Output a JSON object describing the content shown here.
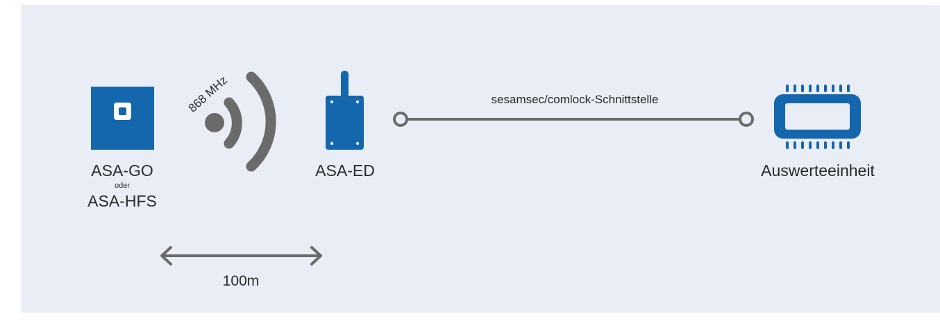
{
  "devices": {
    "sensor": {
      "name_primary": "ASA-GO",
      "connector_word": "oder",
      "name_secondary": "ASA-HFS"
    },
    "radio": {
      "frequency": "868 MHz"
    },
    "receiver": {
      "name": "ASA-ED"
    },
    "interface": {
      "label": "sesamsec/comlock-Schnittstelle"
    },
    "evaluation_unit": {
      "name": "Auswerteeinheit"
    }
  },
  "range": {
    "label": "100m"
  },
  "colors": {
    "background": "#e9edf6",
    "device_blue": "#1466ad",
    "signal_gray": "#6b6b6b",
    "text": "#2a2a2a"
  },
  "icons": {
    "sensor": "square-sensor-icon",
    "radio": "radio-waves-icon",
    "receiver": "antenna-box-icon",
    "evaluation_unit": "chip-icon"
  }
}
